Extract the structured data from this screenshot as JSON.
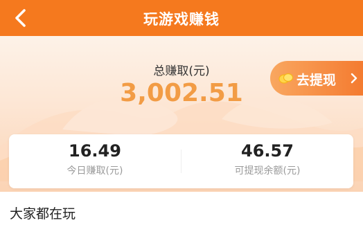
{
  "header": {
    "title": "玩游戏赚钱"
  },
  "summary": {
    "total_label": "总赚取(元)",
    "total_amount": "3,002.51",
    "withdraw_label": "去提现"
  },
  "stats": [
    {
      "value": "16.49",
      "label": "今日赚取(元)"
    },
    {
      "value": "46.57",
      "label": "可提现余额(元)"
    }
  ],
  "section": {
    "title": "大家都在玩"
  },
  "colors": {
    "header": "#f5791e",
    "accent_amount": "#f29c45",
    "button_start": "#f9a760",
    "button_end": "#f47b30"
  },
  "icons": {
    "back": "back-arrow-icon",
    "coin": "coin-icon",
    "chevron": "chevron-right-icon"
  }
}
